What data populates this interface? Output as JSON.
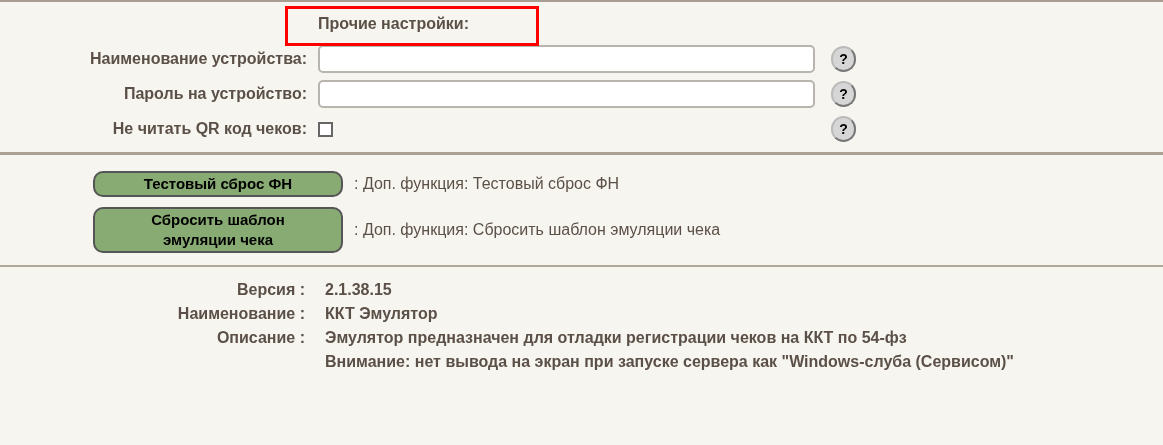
{
  "settings": {
    "title": "Прочие настройки:",
    "highlighted": true,
    "rows": [
      {
        "kind": "text",
        "label": "Наименование устройства:",
        "value": ""
      },
      {
        "kind": "text",
        "label": "Пароль на устройство:",
        "value": ""
      },
      {
        "kind": "checkbox",
        "label": "Не читать QR код чеков:",
        "checked": false
      }
    ],
    "help": "?"
  },
  "functions": [
    {
      "button": "Тестовый сброс ФН",
      "description": ": Доп. функция: Тестовый сброс ФН"
    },
    {
      "button": "Сбросить шаблон эмуляции чека",
      "description": ": Доп. функция: Сбросить шаблон эмуляции чека"
    }
  ],
  "info": [
    {
      "label": "Версия :",
      "value": [
        "2.1.38.15"
      ]
    },
    {
      "label": "Наименование :",
      "value": [
        "ККТ Эмулятор"
      ]
    },
    {
      "label": "Описание :",
      "value": [
        "Эмулятор предназначен для отладки регистрации чеков на ККТ по 54-фз",
        "Внимание: нет вывода на экран при запуске сервера как \"Windows-слуба (Сервисом)\""
      ]
    }
  ]
}
